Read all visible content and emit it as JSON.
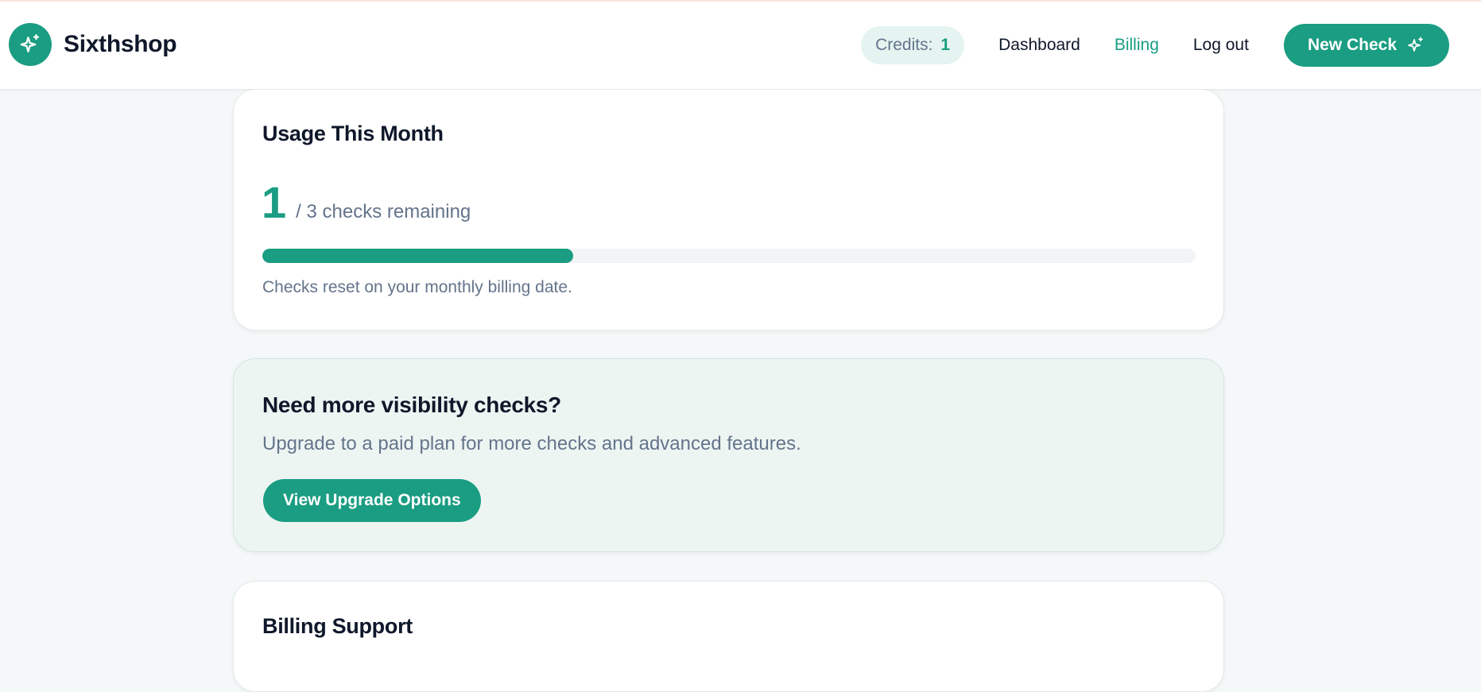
{
  "header": {
    "brand_name": "Sixthshop",
    "brand_icon": "sparkles-icon",
    "credits_label": "Credits:",
    "credits_value": "1",
    "nav": {
      "dashboard": "Dashboard",
      "billing": "Billing",
      "logout": "Log out"
    },
    "new_check_label": "New Check",
    "active_nav": "Billing"
  },
  "usage": {
    "title": "Usage This Month",
    "remaining": "1",
    "rest_text": "/ 3 checks remaining",
    "progress_fraction": 0.333,
    "note": "Checks reset on your monthly billing date."
  },
  "upgrade": {
    "title": "Need more visibility checks?",
    "description": "Upgrade to a paid plan for more checks and advanced features.",
    "button_label": "View Upgrade Options"
  },
  "support": {
    "title": "Billing Support"
  },
  "colors": {
    "accent": "#1a9d82",
    "page_background": "#f5f8f8",
    "upgrade_background": "#edf5f3",
    "muted_text": "#64748b"
  }
}
